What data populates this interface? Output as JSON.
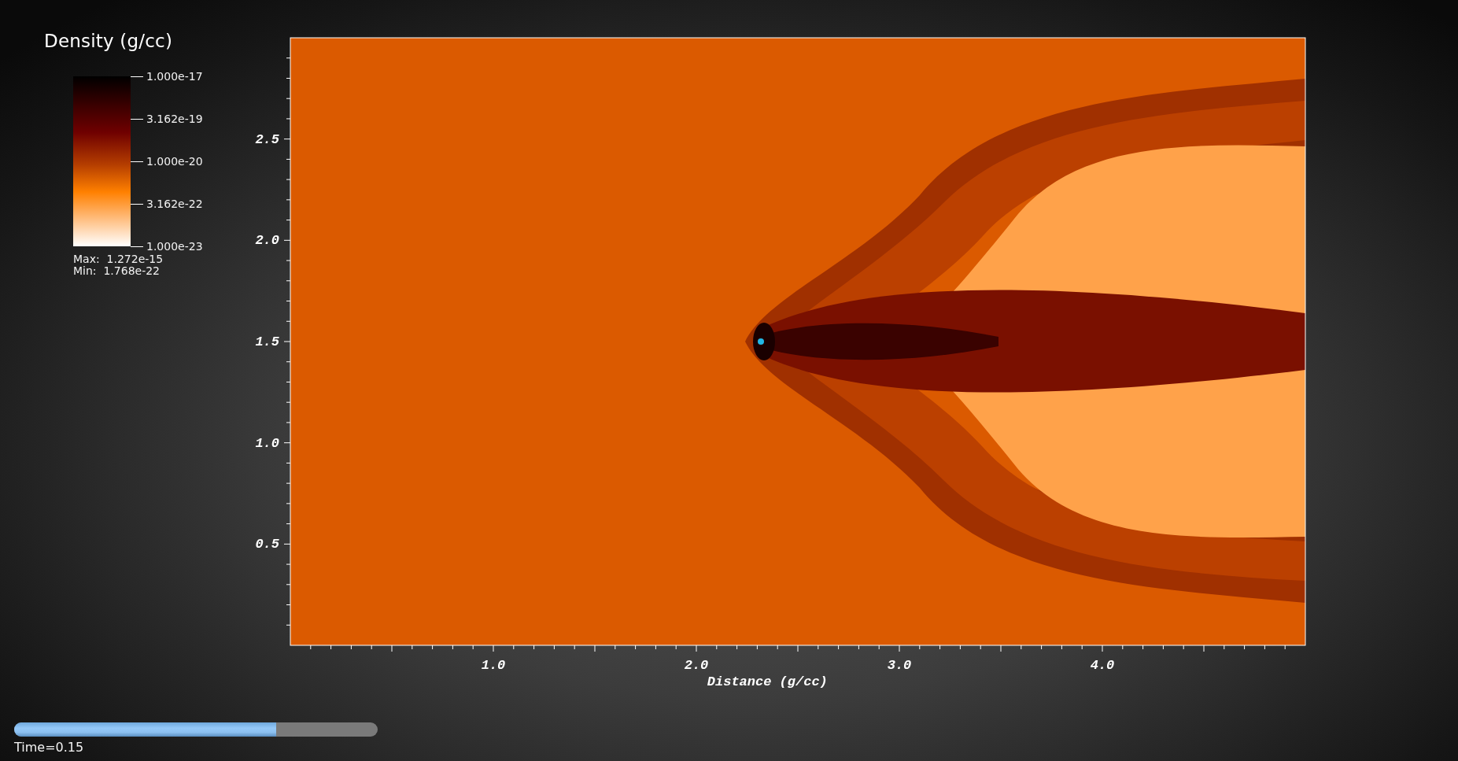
{
  "legend": {
    "title": "Density (g/cc)",
    "ticks": [
      "1.000e-17",
      "3.162e-19",
      "1.000e-20",
      "3.162e-22",
      "1.000e-23"
    ],
    "max": "Max:  1.272e-15",
    "min": "Min:  1.768e-22"
  },
  "plot": {
    "x_axis": {
      "title": "Distance (g/cc)",
      "tick_labels": [
        "1.0",
        "2.0",
        "3.0",
        "4.0"
      ]
    },
    "y_axis": {
      "tick_labels": [
        "2.5",
        "2.0",
        "1.5",
        "1.0",
        "0.5"
      ]
    }
  },
  "time_slider": {
    "level": 0.72,
    "label": "Time=0.15"
  }
}
